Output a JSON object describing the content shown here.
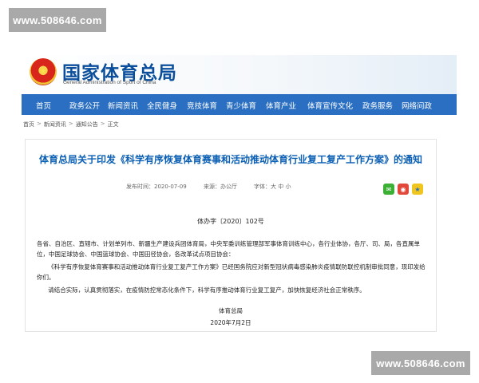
{
  "watermark": {
    "top": "www.508646.com",
    "bottom": "www.508646.com"
  },
  "header": {
    "site_title": "国家体育总局",
    "site_subtitle": "General Administration of Sport of China",
    "emblem_icon": "national-emblem-icon"
  },
  "nav": {
    "items": [
      "首页",
      "政务公开",
      "新闻资讯",
      "全民健身",
      "竞技体育",
      "青少体育",
      "体育产业",
      "体育宣传文化",
      "政务服务",
      "网络问政"
    ]
  },
  "breadcrumb": {
    "items": [
      "首页",
      "新闻资讯",
      "通知公告",
      "正文"
    ],
    "separator": ">"
  },
  "article": {
    "title": "体育总局关于印发《科学有序恢复体育赛事和活动推动体育行业复工复产工作方案》的通知",
    "publish_time": "发布时间：2020-07-09",
    "source": "来源：办公厅",
    "font_size": "字体：大 中 小",
    "doc_number": "体办字〔2020〕102号",
    "paragraphs": [
      "各省、自治区、直辖市、计划单列市、新疆生产建设兵团体育局，中央军委训练管理部军事体育训练中心，各行业体协，各厅、司、局，各直属单位，中国足球协会、中国篮球协会、中国田径协会，各改革试点项目协会：",
      "《科学有序恢复体育赛事和活动推动体育行业复工复产工作方案》已经国务院应对新型冠状病毒感染肺炎疫情联防联控机制审批同意，现印发给你们。",
      "请结合实际，认真贯彻落实，在疫情防控常态化条件下，科学有序推动体育行业复工复产，加快恢复经济社会正常秩序。"
    ],
    "signature": "体育总局",
    "date": "2020年7月2日"
  },
  "share": {
    "wechat_icon": "wechat-icon",
    "weibo_icon": "weibo-icon",
    "qzone_icon": "qzone-icon"
  },
  "colors": {
    "brand": "#0b4f9c",
    "nav_bg": "#2a6fc1",
    "title": "#0b5fb3"
  }
}
